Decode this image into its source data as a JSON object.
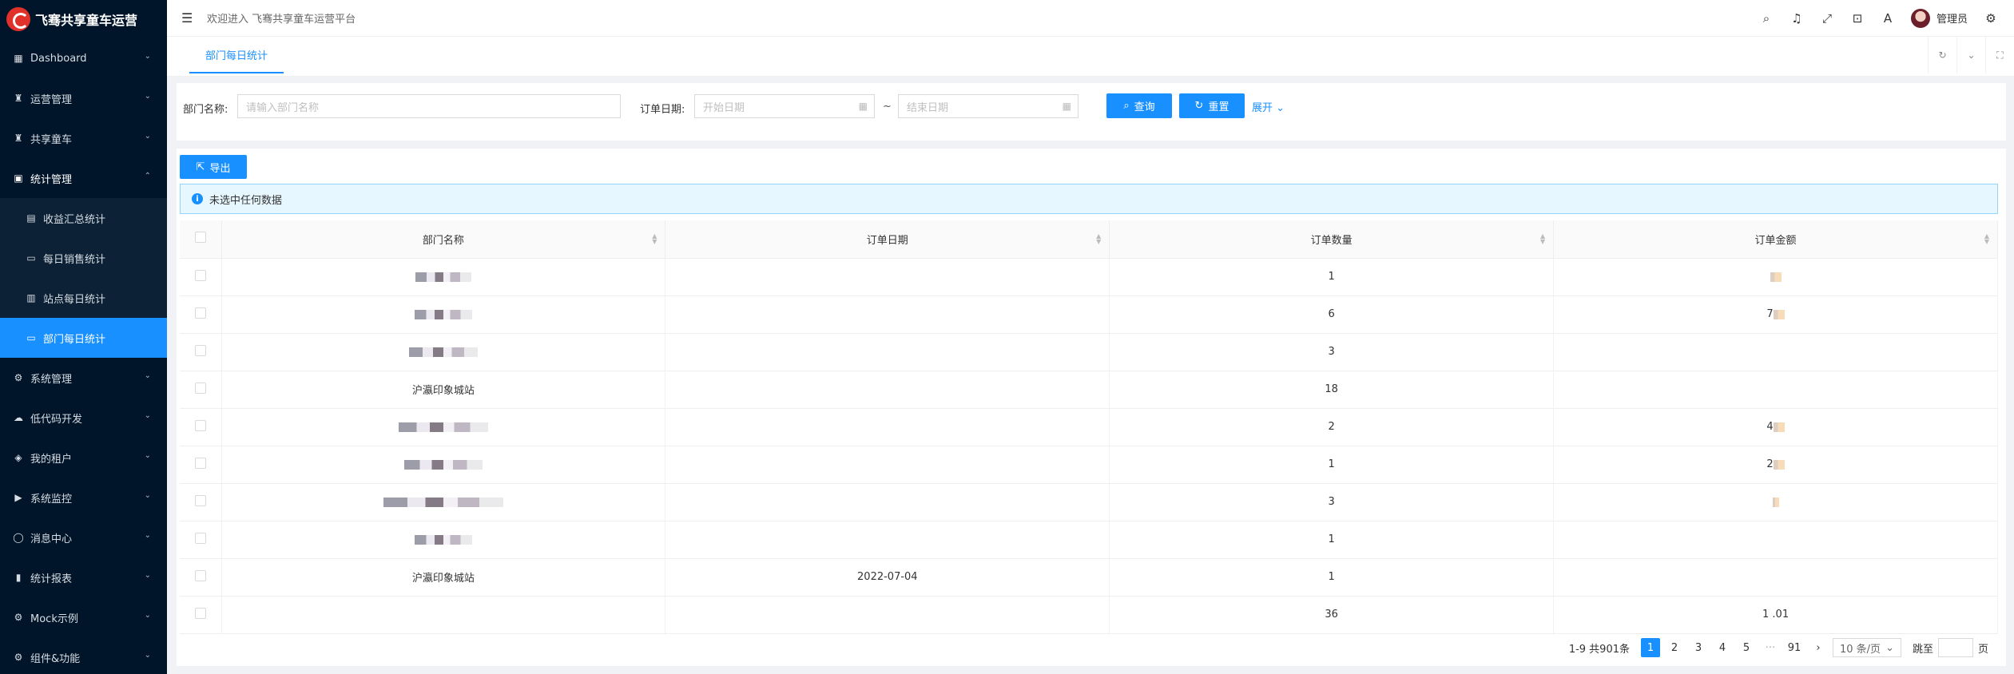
{
  "app": {
    "title": "飞骞共享童车运营"
  },
  "sidebar": {
    "items": [
      {
        "label": "Dashboard",
        "icon": "dashboard-icon"
      },
      {
        "label": "运营管理",
        "icon": "user-icon"
      },
      {
        "label": "共享童车",
        "icon": "user-icon"
      },
      {
        "label": "统计管理",
        "icon": "chart-icon",
        "open": true,
        "children": [
          {
            "label": "收益汇总统计"
          },
          {
            "label": "每日销售统计"
          },
          {
            "label": "站点每日统计"
          },
          {
            "label": "部门每日统计",
            "active": true
          }
        ]
      },
      {
        "label": "系统管理",
        "icon": "gear-icon"
      },
      {
        "label": "低代码开发",
        "icon": "cloud-icon"
      },
      {
        "label": "我的租户",
        "icon": "home-icon"
      },
      {
        "label": "系统监控",
        "icon": "monitor-icon"
      },
      {
        "label": "消息中心",
        "icon": "message-icon"
      },
      {
        "label": "统计报表",
        "icon": "bar-chart-icon"
      },
      {
        "label": "Mock示例",
        "icon": "mock-icon"
      },
      {
        "label": "组件&功能",
        "icon": "component-icon"
      }
    ]
  },
  "header": {
    "welcome": "欢迎进入 飞骞共享童车运营平台",
    "user": "管理员"
  },
  "tabs": [
    {
      "label": "部门每日统计"
    }
  ],
  "search": {
    "dept_label": "部门名称:",
    "dept_placeholder": "请输入部门名称",
    "date_label": "订单日期:",
    "start_placeholder": "开始日期",
    "end_placeholder": "结束日期",
    "range_sep": "~",
    "query": "查询",
    "reset": "重置",
    "expand": "展开"
  },
  "toolbar": {
    "export": "导出"
  },
  "alert": {
    "text": "未选中任何数据"
  },
  "table": {
    "columns": [
      "部门名称",
      "订单日期",
      "订单数量",
      "订单金额"
    ],
    "rows": [
      {
        "dept": "",
        "date": "",
        "count": "1",
        "amount": ""
      },
      {
        "dept": "",
        "date": "",
        "count": "6",
        "amount": "7"
      },
      {
        "dept": "",
        "date": "",
        "count": "3",
        "amount": ""
      },
      {
        "dept": "沪瀛印象城站",
        "date": "",
        "count": "18",
        "amount": ""
      },
      {
        "dept": "",
        "date": "",
        "count": "2",
        "amount": "4"
      },
      {
        "dept": "",
        "date": "",
        "count": "1",
        "amount": "2"
      },
      {
        "dept": "",
        "date": "",
        "count": "3",
        "amount": ""
      },
      {
        "dept": "",
        "date": "",
        "count": "1",
        "amount": ""
      },
      {
        "dept": "沪瀛印象城站",
        "date": "2022-07-04",
        "count": "1",
        "amount": ""
      },
      {
        "dept": "",
        "date": "",
        "count": "36",
        "amount": "1 .01"
      }
    ]
  },
  "pagination": {
    "summary": "1-9 共901条",
    "pages": [
      "1",
      "2",
      "3",
      "4",
      "5",
      "···",
      "91"
    ],
    "active_page": "1",
    "prev": "‹",
    "next": "›",
    "page_size": "10 条/页",
    "jump_label": "跳至",
    "jump_suffix": "页"
  }
}
